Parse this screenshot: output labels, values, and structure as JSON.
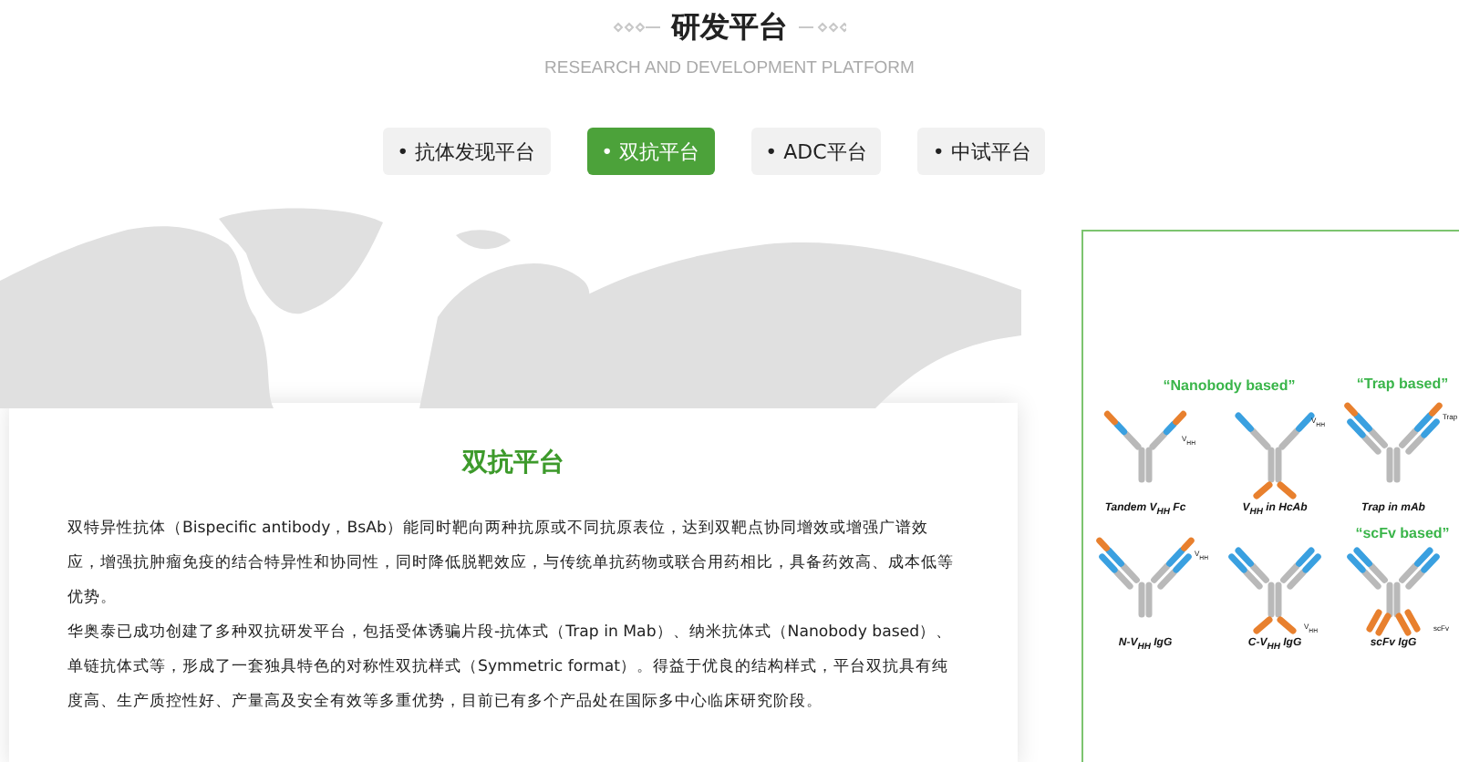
{
  "header": {
    "title": "研发平台",
    "subtitle": "RESEARCH AND DEVELOPMENT PLATFORM"
  },
  "tabs": [
    {
      "label": "• 抗体发现平台",
      "selected": false
    },
    {
      "label": "• 双抗平台",
      "selected": true
    },
    {
      "label": "• ADC平台",
      "selected": false
    },
    {
      "label": "• 中试平台",
      "selected": false
    }
  ],
  "card": {
    "title": "双抗平台",
    "paragraphs": [
      "双特异性抗体（Bispecific antibody，BsAb）能同时靶向两种抗原或不同抗原表位，达到双靶点协同增效或增强广谱效应，增强抗肿瘤免疫的结合特异性和协同性，同时降低脱靶效应，与传统单抗药物或联合用药相比，具备药效高、成本低等优势。",
      "华奥泰已成功创建了多种双抗研发平台，包括受体诱骗片段-抗体式（Trap in Mab）、纳米抗体式（Nanobody based）、单链抗体式等，形成了一套独具特色的对称性双抗样式（Symmetric format）。得益于优良的结构样式，平台双抗具有纯度高、生产质控性好、产量高及安全有效等多重优势，目前已有多个产品处在国际多中心临床研究阶段。"
    ]
  },
  "diagram": {
    "groups": [
      "“Nanobody based”",
      "“Trap based”",
      "“scFv based”"
    ],
    "antibodies": [
      {
        "kind": "tandem",
        "caption": "Tandem V$_{HH}$ Fc",
        "tag": "V$_{HH}$"
      },
      {
        "kind": "hcab",
        "caption": "V$_{HH}$ in HcAb",
        "tag": "V$_{HH}$"
      },
      {
        "kind": "trap",
        "caption": "Trap in mAb",
        "tag": "Trap"
      },
      {
        "kind": "nterm",
        "caption": "N-V$_{HH}$ IgG",
        "tag": "V$_{HH}$"
      },
      {
        "kind": "cterm",
        "caption": "C-V$_{HH}$ IgG",
        "tag": "V$_{HH}$"
      },
      {
        "kind": "scfv",
        "caption": "scFv IgG",
        "tag": "scFv"
      }
    ]
  }
}
